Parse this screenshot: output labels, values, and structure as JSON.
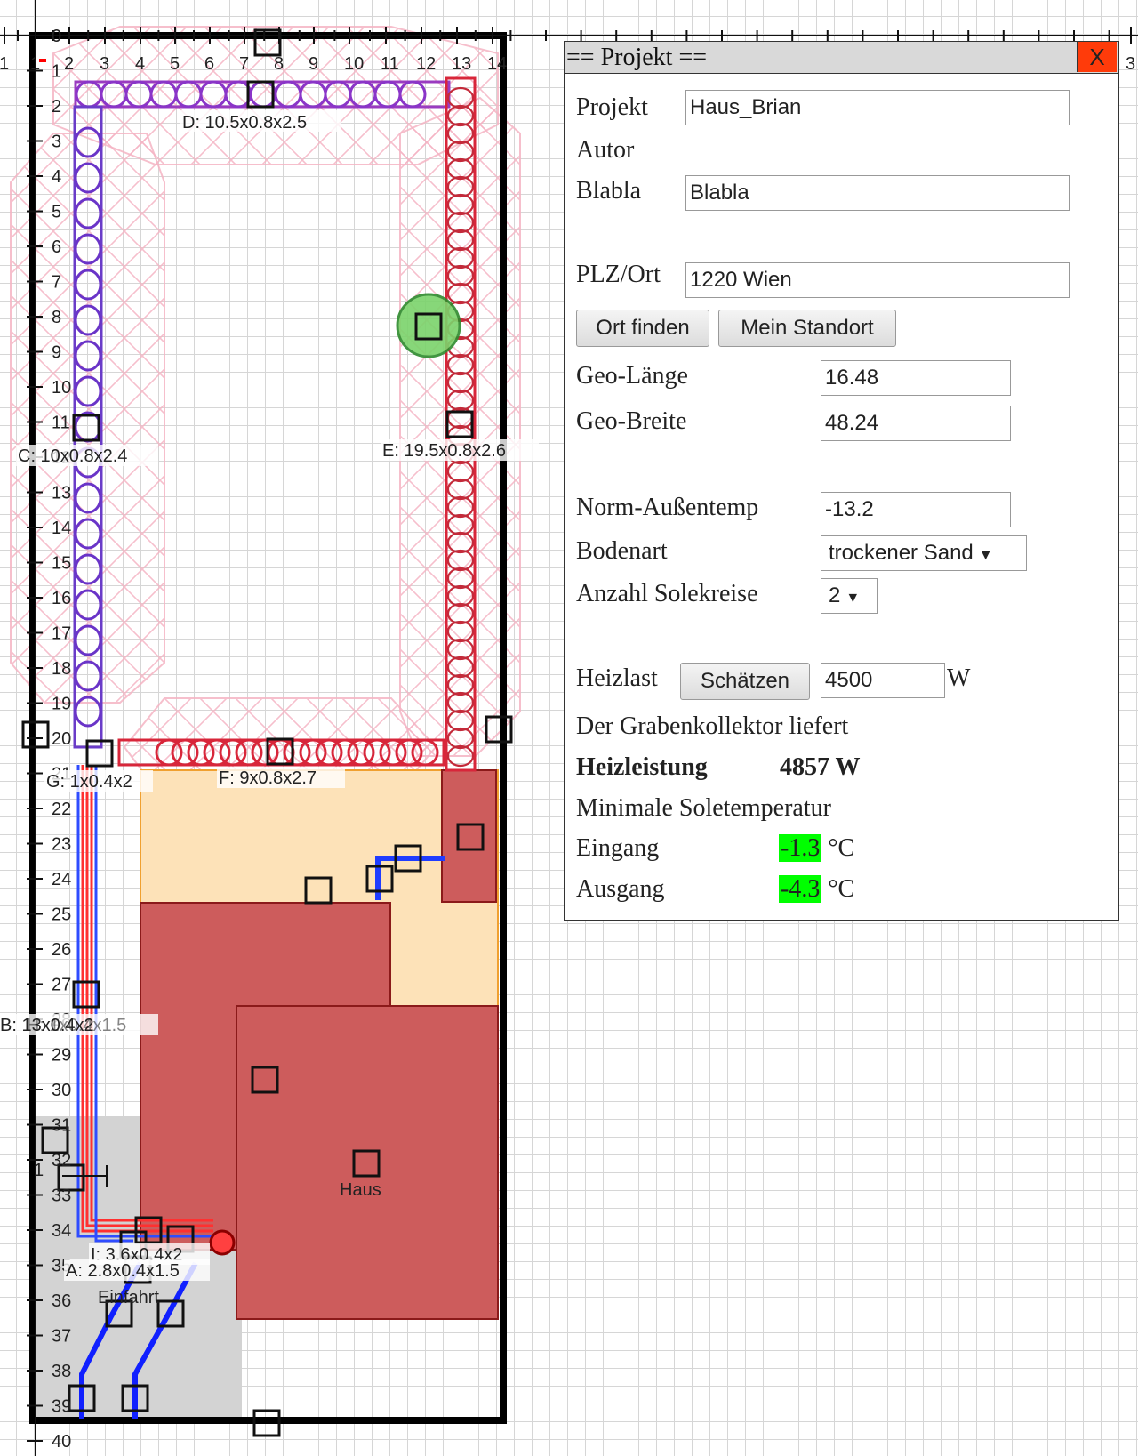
{
  "ruler": {
    "x_labels": [
      "1",
      "1",
      "2",
      "3",
      "4",
      "5",
      "6",
      "7",
      "8",
      "9",
      "10",
      "11",
      "12",
      "13",
      "14",
      "3"
    ],
    "y_labels": [
      "0",
      "1",
      "2",
      "3",
      "4",
      "5",
      "6",
      "7",
      "8",
      "9",
      "10",
      "11",
      "12",
      "13",
      "14",
      "15",
      "16",
      "17",
      "18",
      "19",
      "20",
      "21",
      "22",
      "23",
      "24",
      "25",
      "26",
      "27",
      "28",
      "29",
      "30",
      "31",
      "32",
      "33",
      "34",
      "35",
      "36",
      "37",
      "38",
      "39",
      "40"
    ]
  },
  "canvas_labels": {
    "d": "D: 10.5x0.8x2.5",
    "c": "C: 10x0.8x2.4",
    "e": "E: 19.5x0.8x2.6",
    "f": "F: 9x0.8x2.7",
    "g": "G: 1x0.4x2",
    "b": "B: 13x0.4x2",
    "h": "H: 1x0.4x1.5",
    "i": "I: 3.6x0.4x2",
    "a": "A: 2.8x0.4x1.5",
    "haus": "Haus",
    "einfahrt": "Einfahrt",
    "one": "1"
  },
  "panel": {
    "title": "== Projekt ==",
    "close": "X",
    "projekt_label": "Projekt",
    "projekt_value": "Haus_Brian",
    "autor_label": "Autor",
    "blabla_label": "Blabla",
    "blabla_value": "Blabla",
    "plz_label": "PLZ/Ort",
    "plz_value": "1220 Wien",
    "ort_finden": "Ort finden",
    "mein_standort": "Mein Standort",
    "geo_laenge_label": "Geo-Länge",
    "geo_laenge_value": "16.48",
    "geo_breite_label": "Geo-Breite",
    "geo_breite_value": "48.24",
    "norm_label": "Norm-Außentemp",
    "norm_value": "-13.2",
    "boden_label": "Bodenart",
    "boden_value": "trockener Sand",
    "anzahl_label": "Anzahl Solekreise",
    "anzahl_value": "2",
    "heizlast_label": "Heizlast",
    "schaetzen": "Schätzen",
    "heizlast_value": "4500",
    "heizlast_unit": "W",
    "liefert": "Der Grabenkollektor liefert",
    "heizleistung_label": "Heizleistung",
    "heizleistung_value": "4857 W",
    "min_sole": "Minimale Soletemperatur",
    "eingang_label": "Eingang",
    "eingang_value": "-1.3",
    "ausgang_label": "Ausgang",
    "ausgang_value": "-4.3",
    "deg_unit": "°C"
  },
  "colors": {
    "panel_close": "#ff3b0a",
    "temp_ok": "#00ff00",
    "house": "#cd5c5c",
    "terrace": "#fde2b8",
    "driveway": "#d3d3d3",
    "pipe_purple": "#7b3fc4",
    "pipe_red": "#d8263a",
    "trench_pink": "#f7b9c8"
  }
}
